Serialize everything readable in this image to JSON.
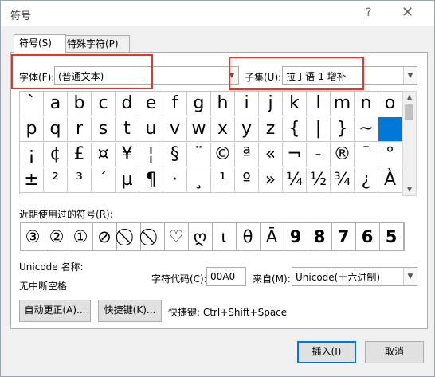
{
  "window": {
    "title": "符号",
    "help": "?",
    "close": "✕"
  },
  "tabs": [
    {
      "label": "符号(S)"
    },
    {
      "label": "特殊字符(P)"
    }
  ],
  "font": {
    "label": "字体(F):",
    "value": "(普通文本)"
  },
  "subset": {
    "label": "子集(U):",
    "value": "拉丁语-1 增补"
  },
  "symbols": [
    [
      "`",
      "a",
      "b",
      "c",
      "d",
      "e",
      "f",
      "g",
      "h",
      "i",
      "j",
      "k",
      "l",
      "m",
      "n",
      "o"
    ],
    [
      "p",
      "q",
      "r",
      "s",
      "t",
      "u",
      "v",
      "w",
      "x",
      "y",
      "z",
      "{",
      "|",
      "}",
      "~",
      ""
    ],
    [
      "¡",
      "¢",
      "£",
      "¤",
      "¥",
      "¦",
      "§",
      "¨",
      "©",
      "ª",
      "«",
      "¬",
      "-",
      "®",
      "¯",
      "°"
    ],
    [
      "±",
      "²",
      "³",
      "´",
      "µ",
      "¶",
      "·",
      "¸",
      "¹",
      "º",
      "»",
      "¼",
      "½",
      "¾",
      "¿",
      "À"
    ]
  ],
  "selected_symbol_index": 31,
  "recent": {
    "label": "近期使用过的符号(R):",
    "items": [
      "③",
      "②",
      "①",
      "⊘",
      "⃠",
      "⃠",
      "♡",
      "ღ",
      "ι",
      "θ",
      "Ā",
      "9",
      "8",
      "7",
      "6",
      "5"
    ]
  },
  "unicode_name_label": "Unicode 名称:",
  "unicode_name_value": "无中断空格",
  "char_code": {
    "label": "字符代码(C):",
    "value": "00A0"
  },
  "from": {
    "label": "来自(M):",
    "value": "Unicode(十六进制)"
  },
  "buttons": {
    "autocorrect": "自动更正(A)...",
    "shortcut_key": "快捷键(K)...",
    "shortcut_text": "快捷键: Ctrl+Shift+Space",
    "insert": "插入(I)",
    "cancel": "取消"
  },
  "colors": {
    "accent": "#0078d7",
    "highlight_box": "#e8342e"
  }
}
